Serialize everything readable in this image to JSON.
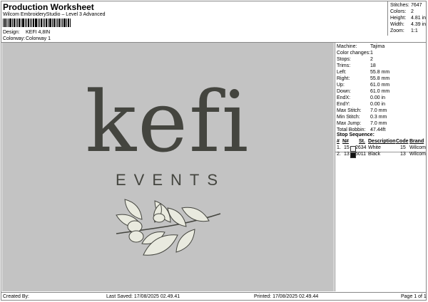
{
  "header": {
    "title": "Production Worksheet",
    "subtitle": "Wilcom EmbroideryStudio – Level 3 Advanced",
    "design_label": "Design:",
    "design_value": "KEFI 4,8IN",
    "colorway_label": "Colorway:",
    "colorway_value": "Colorway 1"
  },
  "stats": [
    {
      "label": "Stitches:",
      "value": "7647"
    },
    {
      "label": "Colors:",
      "value": "2"
    },
    {
      "label": "Height:",
      "value": "4.81 in"
    },
    {
      "label": "Width:",
      "value": "4.39 in"
    },
    {
      "label": "Zoom:",
      "value": "1:1"
    }
  ],
  "machine_info": [
    {
      "label": "Machine:",
      "value": "Tajima"
    },
    {
      "label": "Color changes:",
      "value": "1"
    },
    {
      "label": "Stops:",
      "value": "2"
    },
    {
      "label": "Trims:",
      "value": "18"
    },
    {
      "label": "Left:",
      "value": "55.8 mm"
    },
    {
      "label": "Right:",
      "value": "55.8 mm"
    },
    {
      "label": "Up:",
      "value": "61.0 mm"
    },
    {
      "label": "Down:",
      "value": "61.0 mm"
    },
    {
      "label": "EndX:",
      "value": "0.00 in"
    },
    {
      "label": "EndY:",
      "value": "0.00 in"
    },
    {
      "label": "Max Stitch:",
      "value": "7.0 mm"
    },
    {
      "label": "Min Stitch:",
      "value": "0.3 mm"
    },
    {
      "label": "Max Jump:",
      "value": "7.0 mm"
    },
    {
      "label": "Total Bobbin:",
      "value": "47.44ft"
    }
  ],
  "stop_sequence": {
    "title": "Stop Sequence:",
    "columns": [
      "#",
      "N#",
      "St.",
      "Description",
      "Code",
      "Brand"
    ],
    "rows": [
      {
        "num": "1.",
        "n": "15",
        "color": "#f4f4f4",
        "st": "2634",
        "desc": "White",
        "code": "15",
        "brand": "Wilcom"
      },
      {
        "num": "2.",
        "n": "13",
        "color": "#111111",
        "st": "5011",
        "desc": "Black",
        "code": "13",
        "brand": "Wilcom"
      }
    ]
  },
  "design_art": {
    "wordmark": "kefi",
    "tagline": "EVENTS",
    "thread_dark": "#44453f",
    "thread_light": "#e9eadf"
  },
  "footer": {
    "created": "Created By:",
    "last_saved": "Last Saved: 17/08/2025 02.49.41",
    "printed": "Printed: 17/08/2025 02.49.44",
    "page": "Page 1 of 1"
  }
}
